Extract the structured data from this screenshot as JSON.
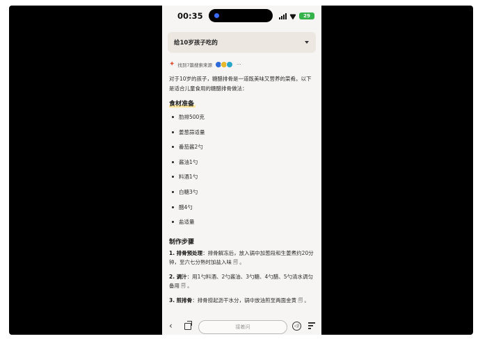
{
  "status_bar": {
    "time": "00:35",
    "battery": "29"
  },
  "query": {
    "text": "给10岁孩子吃的"
  },
  "sources": {
    "text": "找到7篇搜索来源",
    "more": "···"
  },
  "answer": {
    "intro": "对于10岁的孩子，糖醋排骨是一道既美味又营养的菜肴。以下是适合儿童食用的糖醋排骨做法：",
    "ingredients_heading": "食材准备",
    "ingredients": [
      "肋排500克",
      "姜葱蒜适量",
      "番茄酱2勺",
      "酱油1勺",
      "料酒1勺",
      "白糖3勺",
      "醋4勺",
      "盐适量"
    ],
    "steps_heading": "制作步骤",
    "steps": [
      {
        "title": "1. 排骨预处理",
        "text": "：排骨解冻后，放入锅中加葱段和生姜煮约20分钟，至六七分熟时加盐入味",
        "cite": "🗐 。"
      },
      {
        "title": "2. 调汁",
        "text": "：用1勺料酒、2勺酱油、3勺糖、4勺醋、5勺清水调匀备用",
        "cite": "🗐 。"
      },
      {
        "title": "3. 煎排骨",
        "text": "：排骨捞起沥干水分，锅中放油煎至两面金黄",
        "cite": "🗐 。"
      }
    ]
  },
  "bottom_bar": {
    "ask_placeholder": "接着问",
    "back_glyph": "‹",
    "voice_glyph": "◁)"
  },
  "icons": {
    "back": "back-chevron-icon",
    "tabs": "tabs-icon",
    "voice": "voice-icon",
    "menu": "menu-icon",
    "spark": "sparkle-icon"
  },
  "colors": {
    "stage": "#000000",
    "page_bg": "#f6f5f3",
    "query_bg": "#ece7e1",
    "heading_highlight": "#ffe8a3",
    "battery": "#36b24a",
    "spark": "#e2533b"
  }
}
